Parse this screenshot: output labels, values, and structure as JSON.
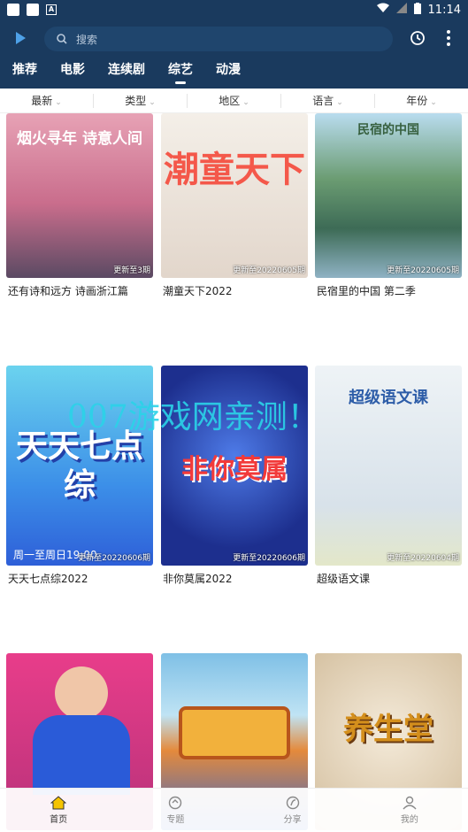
{
  "status": {
    "time": "11:14"
  },
  "search": {
    "placeholder": "搜索"
  },
  "tabs": [
    {
      "label": "推荐",
      "active": false
    },
    {
      "label": "电影",
      "active": false
    },
    {
      "label": "连续剧",
      "active": false
    },
    {
      "label": "综艺",
      "active": true
    },
    {
      "label": "动漫",
      "active": false
    }
  ],
  "filters": [
    "最新",
    "类型",
    "地区",
    "语言",
    "年份"
  ],
  "cards": [
    {
      "title": "还有诗和远方 诗画浙江篇",
      "update": "更新至3期",
      "art": "烟火寻年 诗意人间",
      "colors": [
        "#e7a2b5",
        "#d77fa0"
      ]
    },
    {
      "title": "潮童天下2022",
      "update": "更新至20220605期",
      "art": "潮童天下",
      "colors": [
        "#f2ece4",
        "#e4d9cf"
      ]
    },
    {
      "title": "民宿里的中国 第二季",
      "update": "更新至20220605期",
      "art": "民宿的中国",
      "colors": [
        "#9ec9e6",
        "#5d8f6d"
      ]
    },
    {
      "title": "天天七点综2022",
      "update": "更新至20220606期",
      "art": "天天七点综",
      "colors": [
        "#3c8fe8",
        "#6bd3ee"
      ]
    },
    {
      "title": "非你莫属2022",
      "update": "更新至20220606期",
      "art": "非你莫属",
      "colors": [
        "#1d2f8e",
        "#4464d6"
      ]
    },
    {
      "title": "超级语文课",
      "update": "更新至20220604期",
      "art": "超级语文课",
      "colors": [
        "#e8eef2",
        "#d8e2ea"
      ]
    },
    {
      "title": "",
      "update": "",
      "art": "",
      "colors": [
        "#e83d8a",
        "#b8327a"
      ]
    },
    {
      "title": "",
      "update": "",
      "art": "",
      "colors": [
        "#7fc0e6",
        "#e48a3c"
      ]
    },
    {
      "title": "",
      "update": "",
      "art": "养生堂",
      "colors": [
        "#efe2cf",
        "#d8c4a4"
      ]
    }
  ],
  "art_extra": {
    "card3_time": "周一至周日19:00"
  },
  "watermark": "007游戏网亲测！",
  "bottom_nav": [
    {
      "label": "首页",
      "icon": "home-icon",
      "active": true
    },
    {
      "label": "专题",
      "icon": "topic-icon",
      "active": false
    },
    {
      "label": "分享",
      "icon": "share-icon",
      "active": false
    },
    {
      "label": "我的",
      "icon": "user-icon",
      "active": false
    }
  ]
}
